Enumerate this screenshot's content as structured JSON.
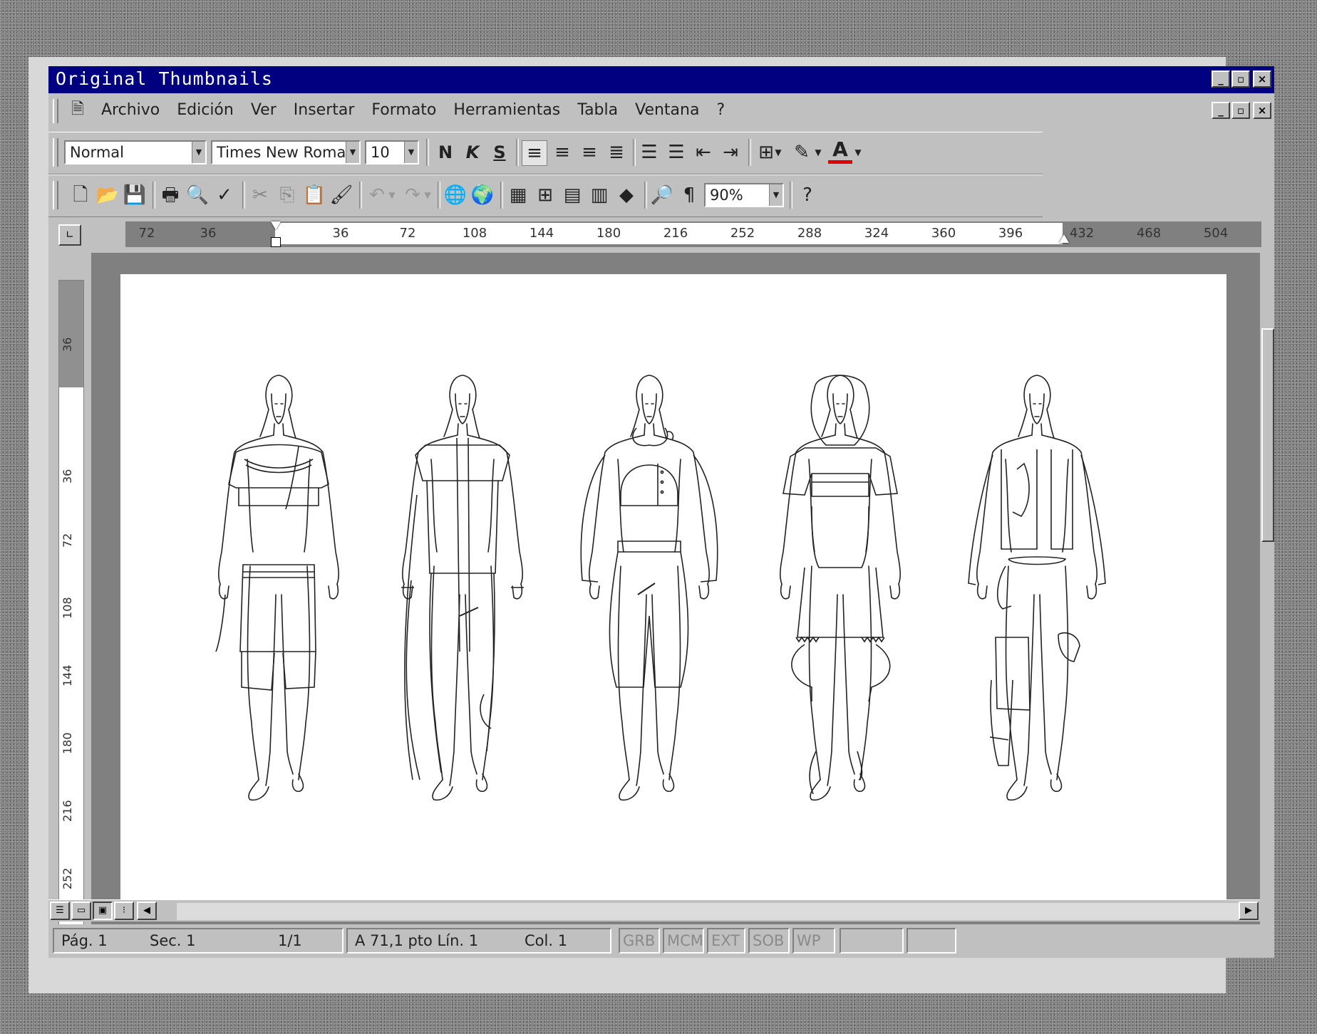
{
  "window": {
    "title": "Original Thumbnails"
  },
  "menubar": {
    "items": [
      {
        "label": "Archivo"
      },
      {
        "label": "Edición"
      },
      {
        "label": "Ver"
      },
      {
        "label": "Insertar"
      },
      {
        "label": "Formato"
      },
      {
        "label": "Herramientas"
      },
      {
        "label": "Tabla"
      },
      {
        "label": "Ventana"
      },
      {
        "label": "?"
      }
    ]
  },
  "formatting": {
    "style": "Normal",
    "font": "Times New Roman",
    "size": "10",
    "bold_label": "N",
    "italic_label": "K",
    "underline_label": "S",
    "font_color": "#e00000"
  },
  "standard": {
    "zoom": "90%"
  },
  "ruler": {
    "h_labels": [
      "72",
      "36",
      "36",
      "72",
      "108",
      "144",
      "180",
      "216",
      "252",
      "288",
      "324",
      "360",
      "396",
      "432",
      "468",
      "504"
    ],
    "v_labels": [
      "36",
      "36",
      "72",
      "108",
      "144",
      "180",
      "216",
      "252"
    ]
  },
  "statusbar": {
    "page": "Pág. 1",
    "section": "Sec. 1",
    "pages": "1/1",
    "position": "A 71,1 pto Lín. 1",
    "column": "Col. 1",
    "grb": "GRB",
    "mcm": "MCM",
    "ext": "EXT",
    "sob": "SOB",
    "wp": "WP"
  },
  "colors": {
    "titlebar": "#000080",
    "chrome": "#c0c0c0"
  }
}
